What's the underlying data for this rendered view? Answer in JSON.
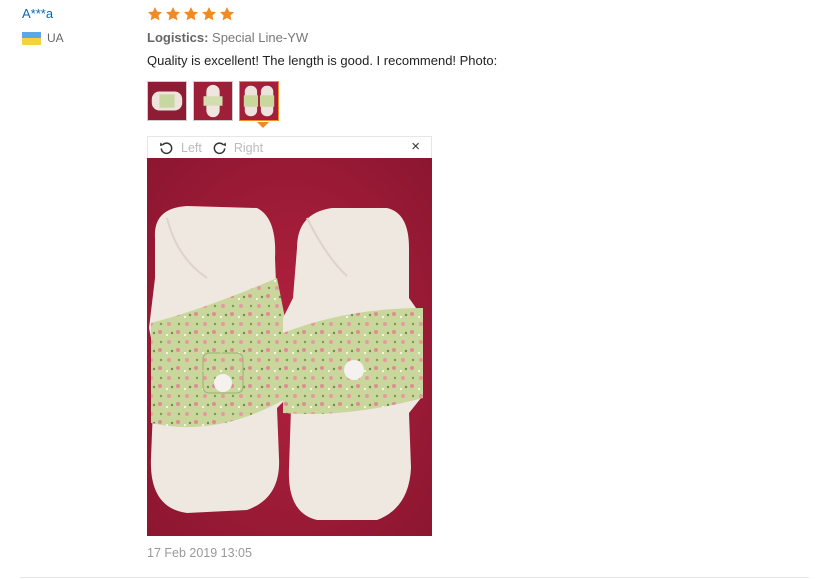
{
  "user": {
    "name": "A***a",
    "country": "UA",
    "flag_colors": [
      "#5aa9e6",
      "#f5d33e"
    ]
  },
  "review": {
    "rating": 5,
    "star_color": "#f08a24",
    "logistics_label": "Logistics:",
    "logistics_value": "Special Line-YW",
    "text": "Quality is excellent! The length is good. I recommend! Photo:",
    "date": "17 Feb 2019 13:05"
  },
  "thumbnails": {
    "count": 3,
    "active_index": 2
  },
  "viewer": {
    "rotate_left_label": "Left",
    "rotate_right_label": "Right",
    "close_symbol": "×"
  },
  "icons": [
    "star-icon",
    "rotate-left-icon",
    "rotate-right-icon",
    "close-icon"
  ],
  "colors": {
    "link": "#0569b5",
    "accent": "#f08a24",
    "photo_bg": "#a51d3a"
  }
}
